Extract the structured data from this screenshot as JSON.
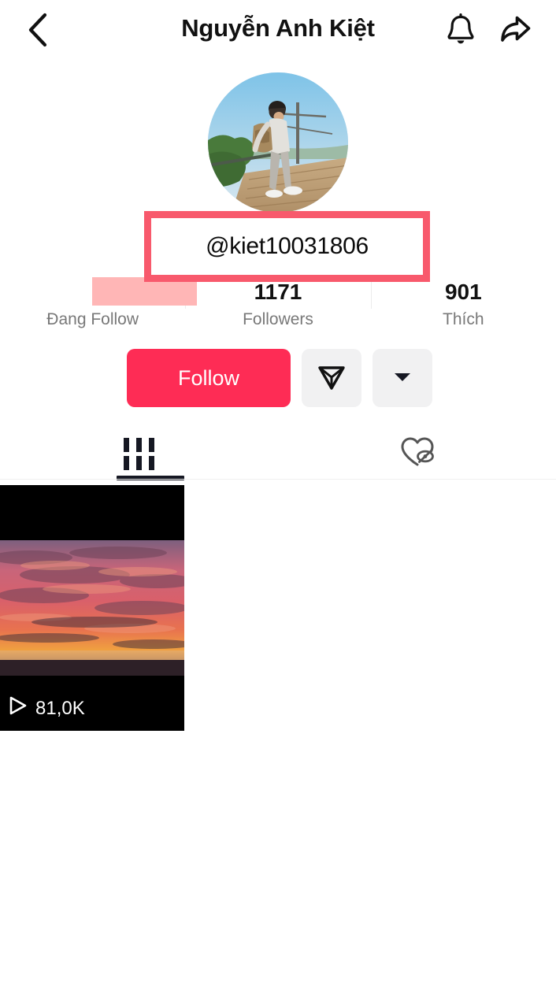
{
  "header": {
    "back_icon": "chevron-left-icon",
    "title": "Nguyễn Anh Kiệt",
    "bell_icon": "bell-icon",
    "share_icon": "share-arrow-icon"
  },
  "profile": {
    "avatar_alt": "profile-photo-person-with-backpack-on-wooden-deck",
    "username": "@kiet10031806",
    "highlight_color": "#F8596C",
    "redaction_color": "#FFB6B6"
  },
  "stats": [
    {
      "value": "",
      "label": "Đang Follow",
      "redacted": true
    },
    {
      "value": "1171",
      "label": "Followers",
      "redacted": false
    },
    {
      "value": "901",
      "label": "Thích",
      "redacted": false
    }
  ],
  "actions": {
    "follow_label": "Follow",
    "follow_color": "#FE2C55",
    "message_icon": "send-message-icon",
    "more_icon": "chevron-down-icon"
  },
  "tabs": [
    {
      "id": "videos",
      "icon": "grid-videos-icon",
      "active": true
    },
    {
      "id": "liked",
      "icon": "heart-hidden-icon",
      "active": false
    }
  ],
  "videos": [
    {
      "play_icon": "play-icon",
      "play_count": "81,0K"
    }
  ]
}
